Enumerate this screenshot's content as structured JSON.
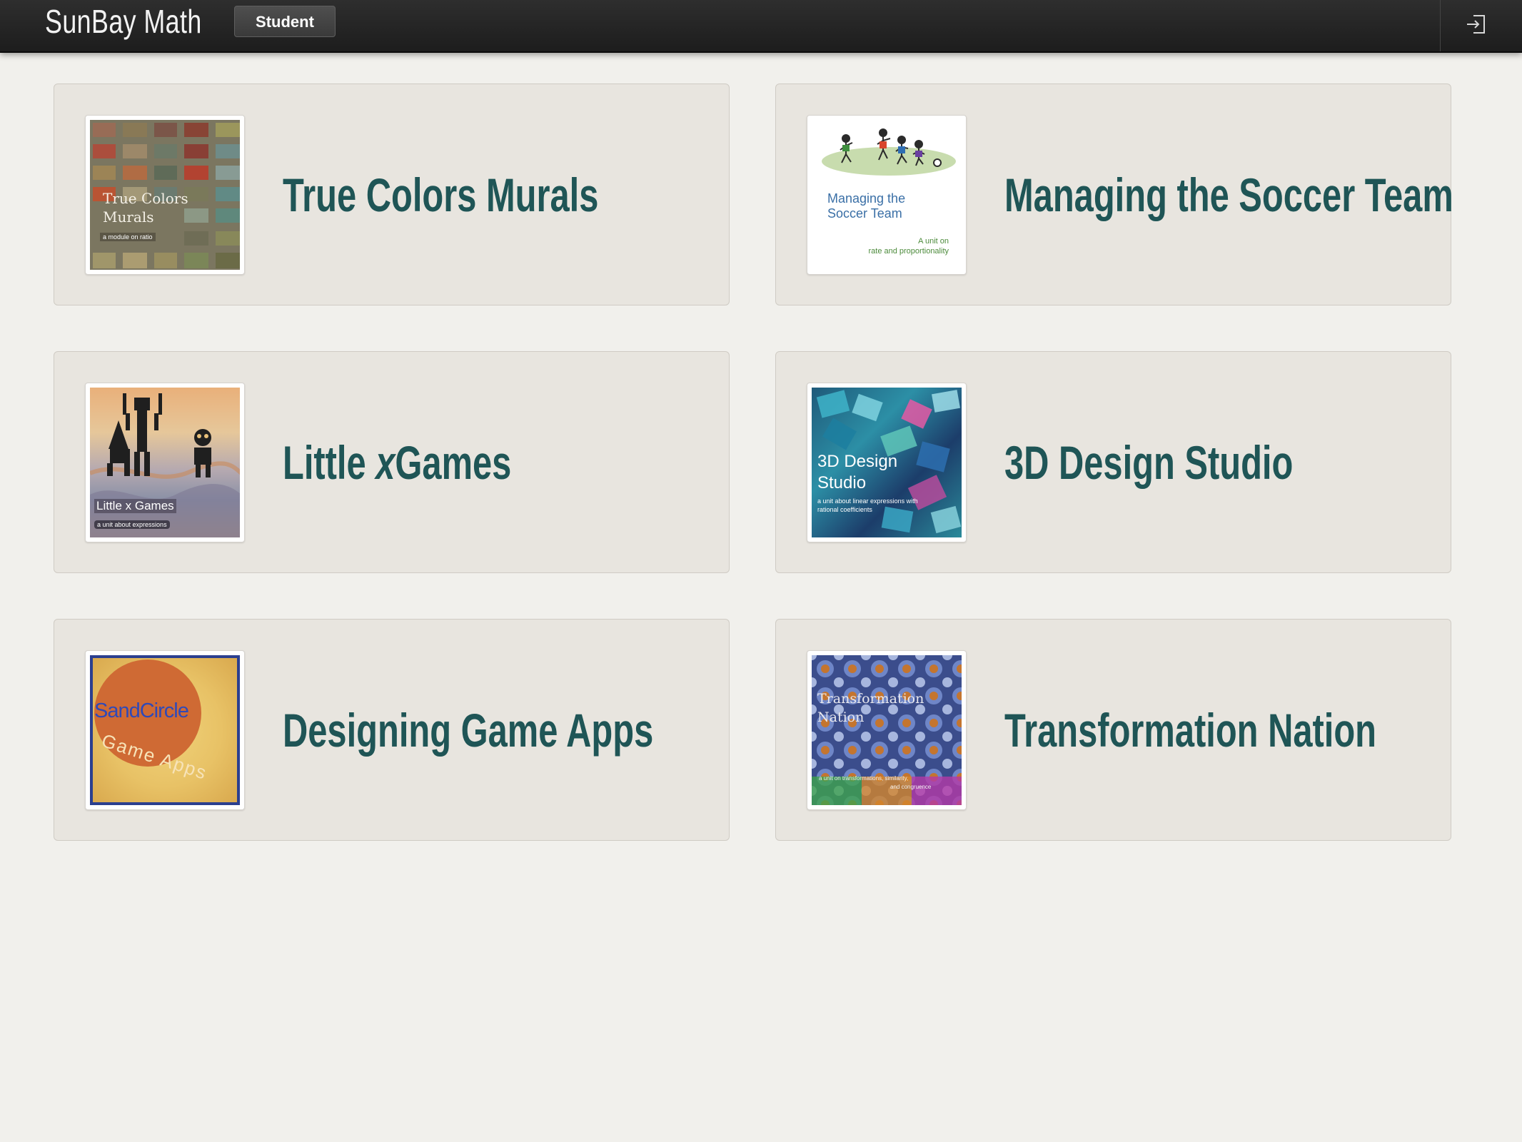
{
  "header": {
    "app_title": "SunBay Math",
    "role_badge": "Student",
    "signout_icon": "sign-out-icon"
  },
  "colors": {
    "topbar": "#232323",
    "page_background": "#f1f0ec",
    "card_background": "#e8e5df",
    "title_teal": "#1f5556"
  },
  "units": [
    {
      "title": "True Colors Murals",
      "cover": {
        "title_line1": "True Colors",
        "title_line2": "Murals",
        "subtitle": "a module on ratio"
      }
    },
    {
      "title": "Managing the Soccer Team",
      "cover": {
        "title_line1": "Managing the",
        "title_line2": "Soccer Team",
        "subtitle_line1": "A unit on",
        "subtitle_line2": "rate and proportionality"
      }
    },
    {
      "title_before": "Little ",
      "title_var": "x",
      "title_after": "Games",
      "cover": {
        "title": "Little x Games",
        "subtitle": "a unit about expressions"
      }
    },
    {
      "title": "3D Design Studio",
      "cover": {
        "title_line1": "3D Design",
        "title_line2": "Studio",
        "subtitle_line1": "a unit about linear expressions with",
        "subtitle_line2": "rational coefficients"
      }
    },
    {
      "title": "Designing Game Apps",
      "cover": {
        "title_line1": "SandCircle",
        "title_line2": "Game Apps"
      }
    },
    {
      "title": "Transformation Nation",
      "cover": {
        "title_line1": "Transformation",
        "title_line2": "Nation",
        "subtitle_line1": "a unit on transformations, similarity,",
        "subtitle_line2": "and congruence"
      }
    }
  ]
}
